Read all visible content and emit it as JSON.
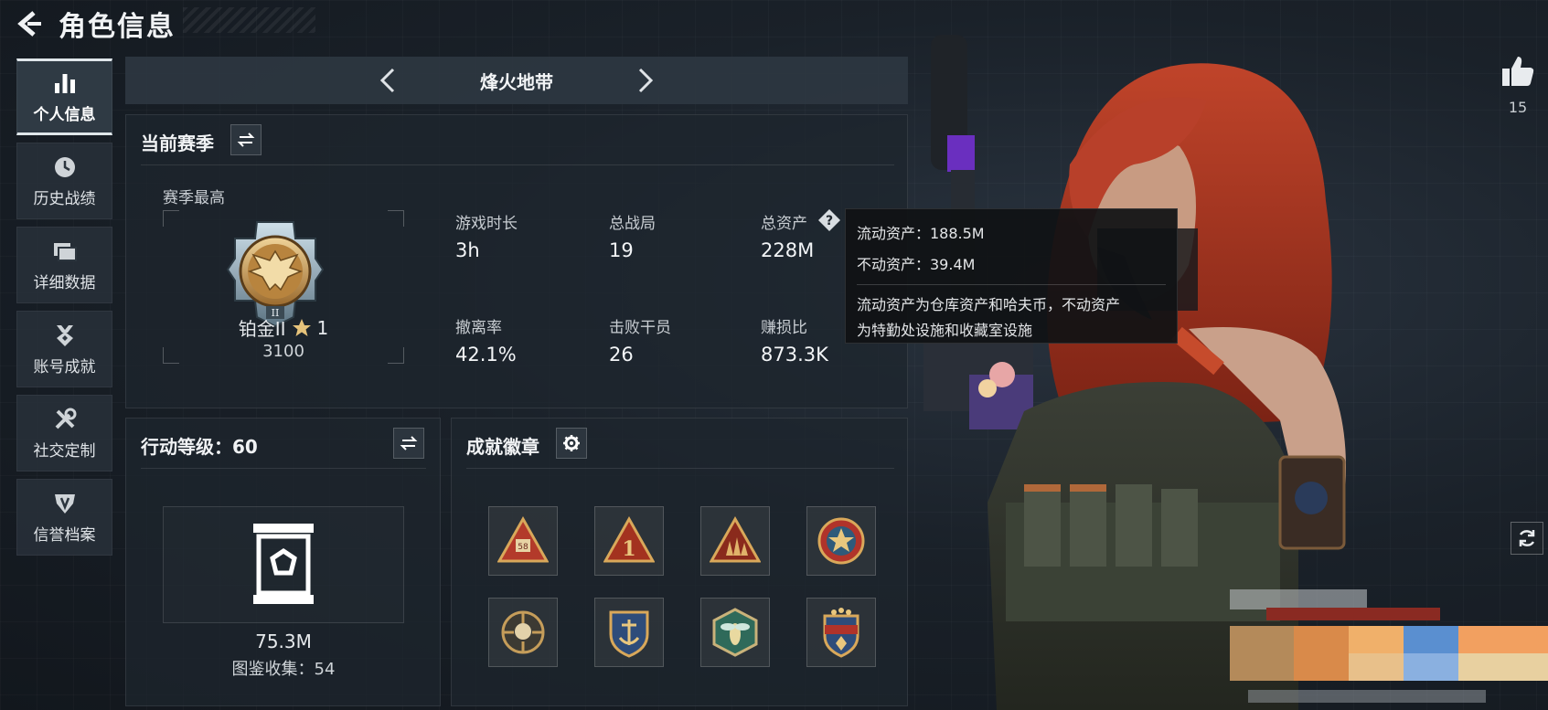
{
  "header": {
    "title": "角色信息"
  },
  "sidebar": {
    "items": [
      {
        "label": "个人信息",
        "icon": "bar-chart-icon",
        "active": true
      },
      {
        "label": "历史战绩",
        "icon": "clock-icon",
        "active": false
      },
      {
        "label": "详细数据",
        "icon": "folders-icon",
        "active": false
      },
      {
        "label": "账号成就",
        "icon": "medal-icon",
        "active": false
      },
      {
        "label": "社交定制",
        "icon": "tools-icon",
        "active": false
      },
      {
        "label": "信誉档案",
        "icon": "shield-icon",
        "active": false
      }
    ]
  },
  "mode": {
    "title": "烽火地带"
  },
  "season": {
    "title": "当前赛季",
    "best_label": "赛季最高",
    "rank_name": "铂金II",
    "rank_stars": "1",
    "rank_score": "3100",
    "stats": [
      {
        "label": "游戏时长",
        "value": "3h"
      },
      {
        "label": "总战局",
        "value": "19"
      },
      {
        "label": "总资产",
        "value": "228M"
      },
      {
        "label": "撤离率",
        "value": "42.1%"
      },
      {
        "label": "击败干员",
        "value": "26"
      },
      {
        "label": "赚损比",
        "value": "873.3K"
      }
    ]
  },
  "tooltip": {
    "liquid": "流动资产：188.5M",
    "fixed": "不动资产：39.4M",
    "desc_line1": "流动资产为仓库资产和哈夫币，不动资产",
    "desc_line2": "为特勤处设施和收藏室设施"
  },
  "action_level": {
    "title": "行动等级：60",
    "collection_value": "75.3M",
    "collection_label": "图鉴收集：54"
  },
  "achievements": {
    "title": "成就徽章",
    "badges": [
      "triangle-badge-58-icon",
      "triangle-badge-1-icon",
      "triangle-badge-soldiers-icon",
      "round-star-badge-icon",
      "skull-crosshair-badge-icon",
      "shield-anchor-badge-icon",
      "hexagon-wasp-badge-icon",
      "stars-shield-badge-icon"
    ]
  },
  "social": {
    "likes": "15"
  },
  "colors": {
    "accent": "#c89a4a",
    "panel": "#1e252d",
    "background": "#161c22"
  }
}
